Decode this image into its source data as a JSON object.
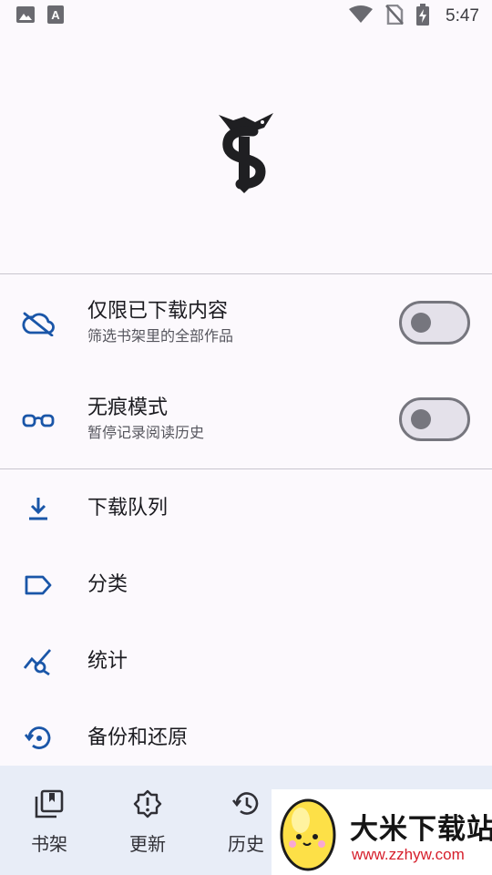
{
  "status_bar": {
    "time": "5:47",
    "icons": [
      "image-icon",
      "a-app-icon",
      "wifi-icon",
      "no-sim-icon",
      "battery-charging-icon"
    ]
  },
  "app": {
    "logo": "snake-s-logo"
  },
  "toggles": [
    {
      "title": "仅限已下载内容",
      "subtitle": "筛选书架里的全部作品",
      "icon": "cloud-off-icon",
      "on": false
    },
    {
      "title": "无痕模式",
      "subtitle": "暂停记录阅读历史",
      "icon": "glasses-icon",
      "on": false
    }
  ],
  "menu": [
    {
      "label": "下载队列",
      "icon": "download-icon"
    },
    {
      "label": "分类",
      "icon": "label-icon"
    },
    {
      "label": "统计",
      "icon": "query-stats-icon"
    },
    {
      "label": "备份和还原",
      "icon": "restore-icon"
    }
  ],
  "bottom_nav": [
    {
      "label": "书架",
      "icon": "library-icon"
    },
    {
      "label": "更新",
      "icon": "updates-alert-icon"
    },
    {
      "label": "历史",
      "icon": "history-icon"
    }
  ],
  "watermark": {
    "title": "大米下载站",
    "url": "www.zzhyw.com"
  },
  "colors": {
    "accent": "#1a56a8",
    "background": "#fcf9fd",
    "nav_background": "#e8edf7",
    "watermark_url": "#d61f2c"
  }
}
